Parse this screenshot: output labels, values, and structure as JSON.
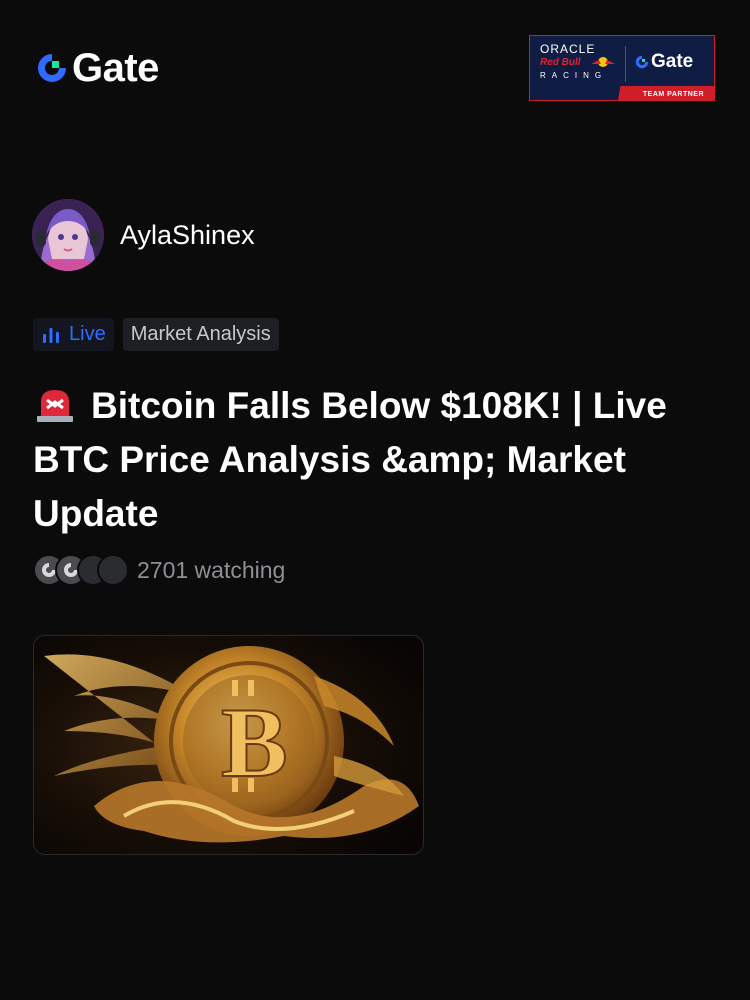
{
  "header": {
    "logo_text": "Gate",
    "partner": {
      "oracle": "ORACLE",
      "redbull": "Red Bull",
      "racing": "RACING",
      "gate": "Gate",
      "team_partner": "TEAM PARTNER"
    }
  },
  "author": {
    "name": "AylaShinex"
  },
  "tags": {
    "live": "Live",
    "category": "Market Analysis"
  },
  "post": {
    "title": "Bitcoin Falls Below $108K! | Live BTC Price Analysis &amp; Market Update",
    "watching": "2701 watching"
  },
  "colors": {
    "background": "#0b0b0c",
    "accent_blue": "#2f6bff",
    "gold": "#d4a23a"
  },
  "icons": {
    "title_prefix": "siren-icon",
    "live": "bar-chart-icon"
  }
}
